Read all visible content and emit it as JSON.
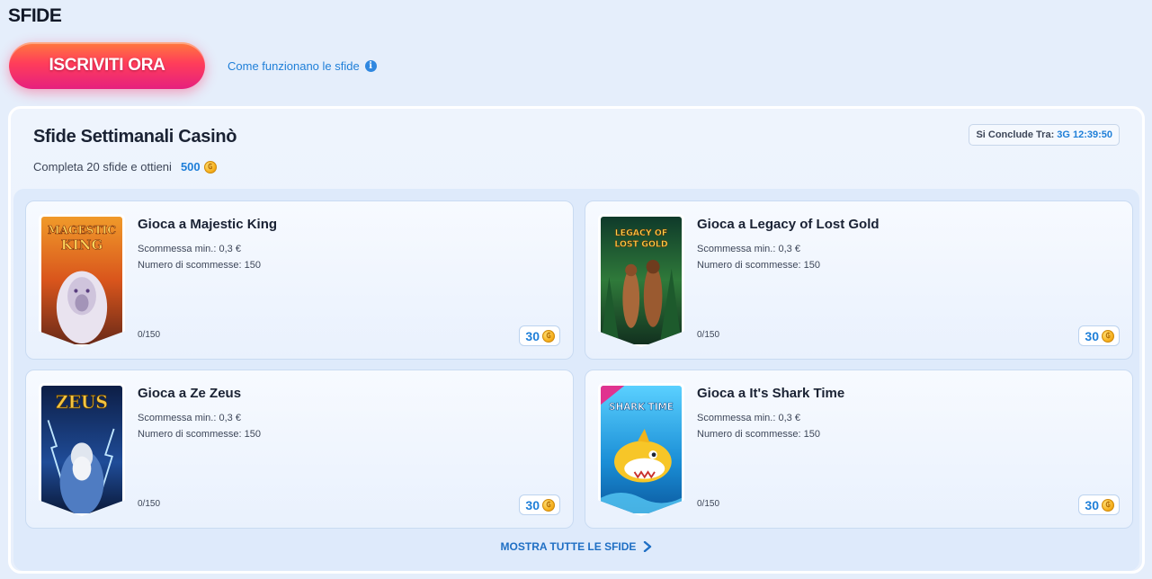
{
  "page": {
    "title": "SFIDE"
  },
  "header": {
    "cta_label": "ISCRIVITI ORA",
    "how_link": "Come funzionano le sfide"
  },
  "challenge_panel": {
    "title": "Sfide Settimanali Casinò",
    "subtitle_prefix": "Completa 20 sfide e ottieni",
    "total_reward": "500",
    "countdown_label": "Si Conclude Tra:",
    "countdown_value": "3G 12:39:50",
    "show_all_label": "MOSTRA TUTTE LE SFIDE",
    "cards": [
      {
        "title": "Gioca a Majestic King",
        "min_bet": "Scommessa min.: 0,3 €",
        "num_bets": "Numero di scommesse: 150",
        "progress": "0/150",
        "reward": "30",
        "thumb_text": [
          "MAGESTIC",
          "KING"
        ]
      },
      {
        "title": "Gioca a Legacy of Lost Gold",
        "min_bet": "Scommessa min.: 0,3 €",
        "num_bets": "Numero di scommesse: 150",
        "progress": "0/150",
        "reward": "30",
        "thumb_text": [
          "LEGACY OF",
          "LOST GOLD"
        ]
      },
      {
        "title": "Gioca a Ze Zeus",
        "min_bet": "Scommessa min.: 0,3 €",
        "num_bets": "Numero di scommesse: 150",
        "progress": "0/150",
        "reward": "30",
        "thumb_text": [
          "ZEUS"
        ]
      },
      {
        "title": "Gioca a It's Shark Time",
        "min_bet": "Scommessa min.: 0,3 €",
        "num_bets": "Numero di scommesse: 150",
        "progress": "0/150",
        "reward": "30",
        "thumb_text": [
          "SHARK TIME"
        ]
      }
    ]
  },
  "colors": {
    "accent": "#1f7fd8",
    "cta_start": "#ff7a3c",
    "cta_end": "#e6207e",
    "background": "#e5eefb"
  },
  "icons": {
    "info": "info-icon",
    "coin": "coin-icon",
    "chevron": "chevron-right-icon"
  }
}
